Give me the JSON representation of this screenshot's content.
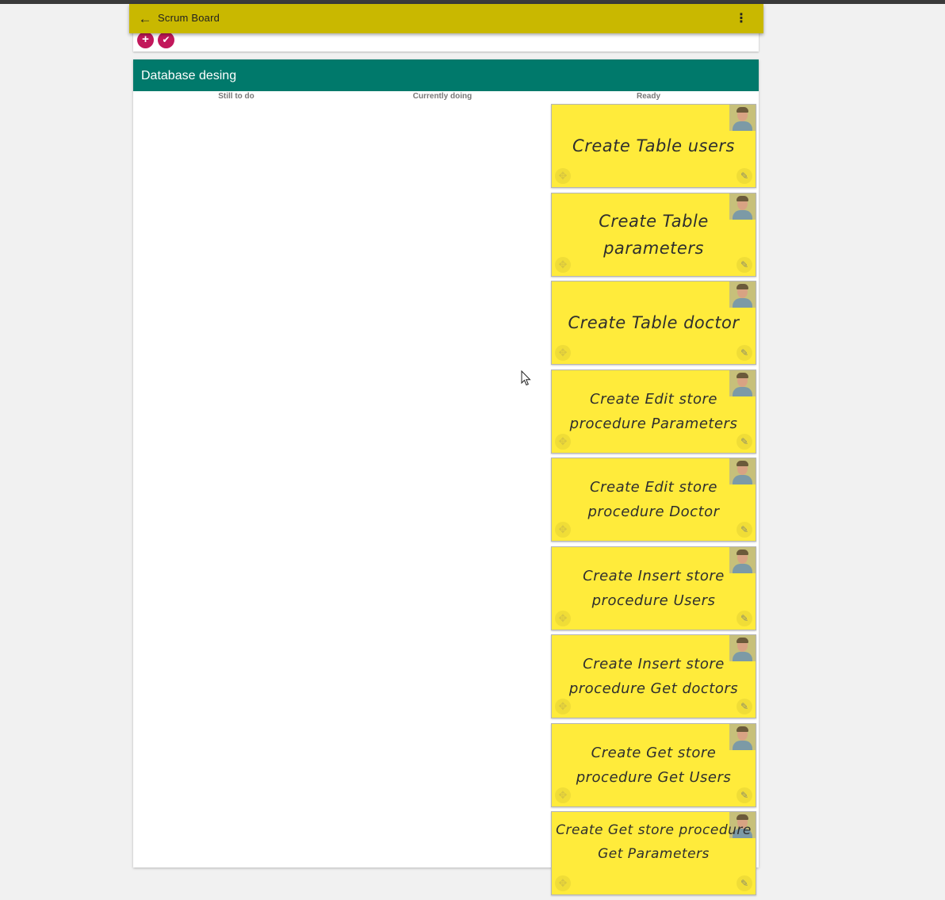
{
  "appbar": {
    "title": "Scrum Board",
    "back_icon": "arrow-back-icon",
    "more_icon": "more-vert-icon",
    "color": "#c9b800"
  },
  "actions": {
    "add_icon": "plus-icon",
    "done_icon": "check-icon",
    "color": "#c2185b"
  },
  "board": {
    "title": "Database desing",
    "header_color": "#00796b",
    "columns": [
      "Still to do",
      "Currently doing",
      "Ready"
    ],
    "cards": [
      {
        "text": "Create Table users"
      },
      {
        "text": "Create Table parameters"
      },
      {
        "text": "Create Table doctor"
      },
      {
        "text": "Create Edit store procedure Parameters"
      },
      {
        "text": "Create Edit store procedure Doctor"
      },
      {
        "text": "Create Insert store procedure Users"
      },
      {
        "text": "Create Insert store procedure Get doctors"
      },
      {
        "text": "Create Get store procedure Get Users"
      },
      {
        "text": "Create Get store procedure Get Parameters"
      }
    ],
    "card_color": "#ffeb3b"
  }
}
